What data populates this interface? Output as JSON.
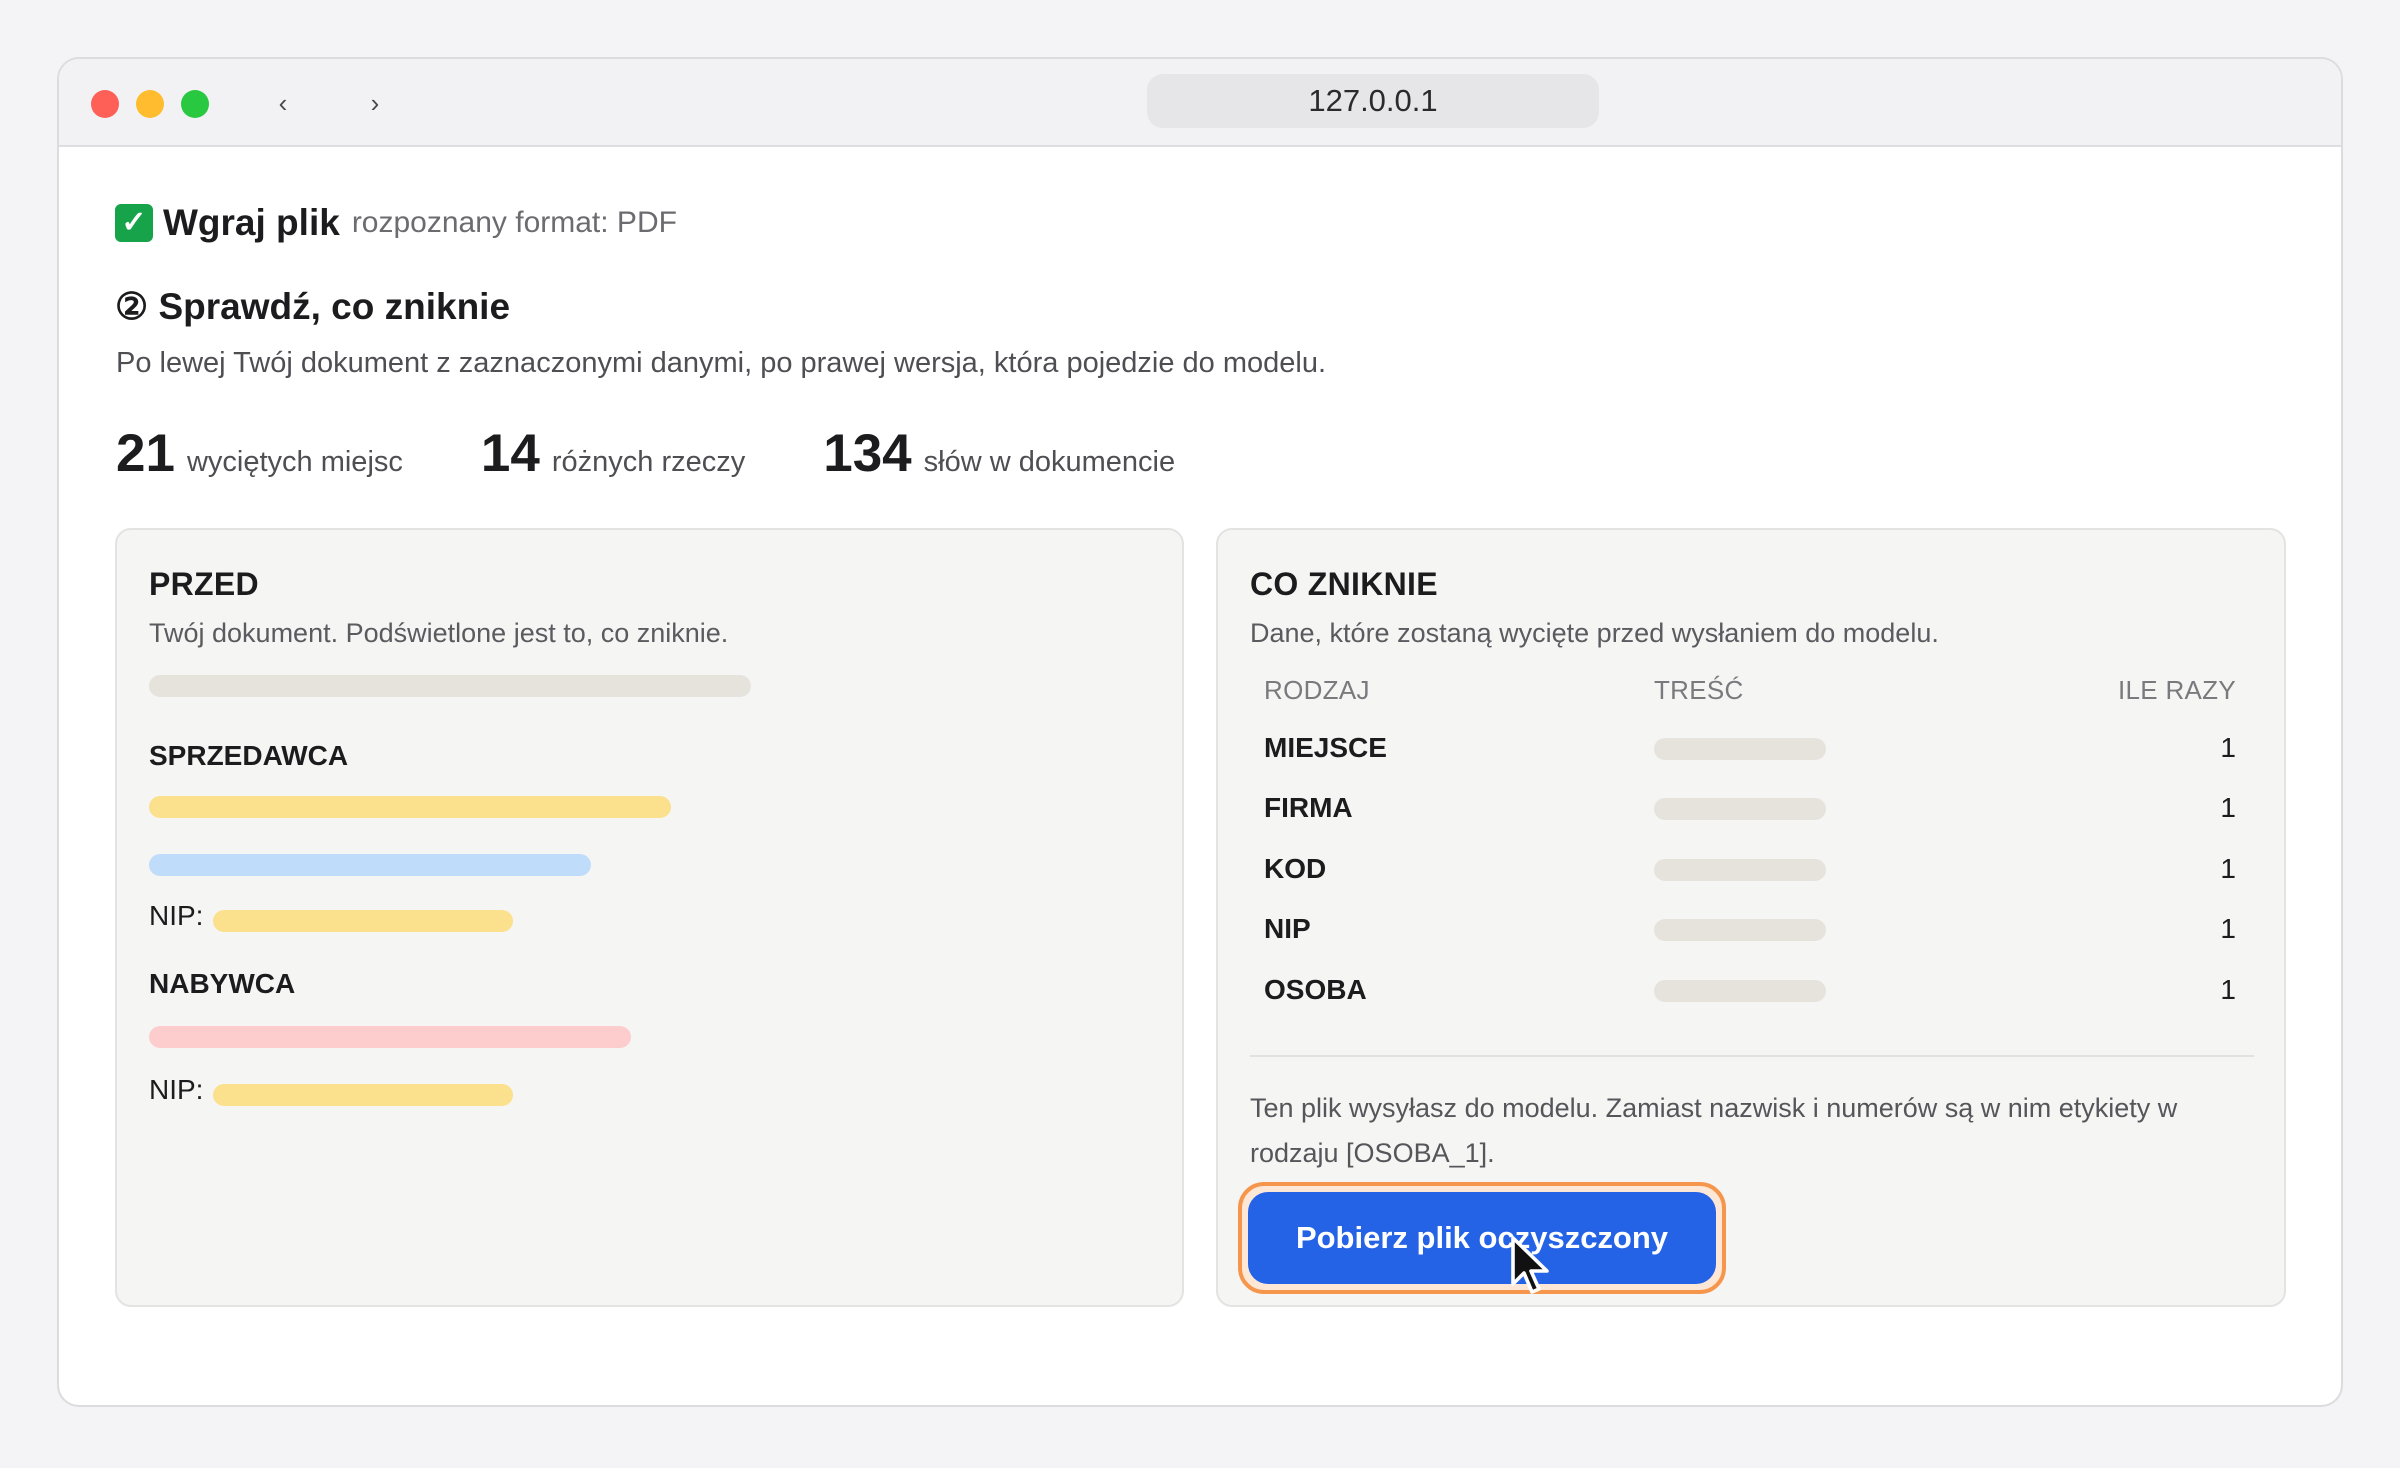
{
  "browser": {
    "url": "127.0.0.1",
    "back_icon": "‹",
    "forward_icon": "›"
  },
  "step1": {
    "check_icon": "✓",
    "title": "Wgraj plik",
    "subtitle": "rozpoznany format: PDF"
  },
  "step2": {
    "title": "② Sprawdź, co zniknie",
    "description": "Po lewej Twój dokument z zaznaczonymi danymi, po prawej wersja, która pojedzie do modelu."
  },
  "stats": [
    {
      "value": "21",
      "label": "wyciętych miejsc"
    },
    {
      "value": "14",
      "label": "różnych rzeczy"
    },
    {
      "value": "134",
      "label": "słów w dokumencie"
    }
  ],
  "before": {
    "title": "PRZED",
    "subtitle": "Twój dokument. Podświetlone jest to, co zniknie.",
    "seller_label": "SPRZEDAWCA",
    "buyer_label": "NABYWCA",
    "nip_label": "NIP:"
  },
  "removed": {
    "title": "CO ZNIKNIE",
    "subtitle": "Dane, które zostaną wycięte przed wysłaniem do modelu.",
    "columns": [
      "RODZAJ",
      "TREŚĆ",
      "ILE RAZY"
    ],
    "rows": [
      {
        "kind": "MIEJSCE",
        "count": "1"
      },
      {
        "kind": "FIRMA",
        "count": "1"
      },
      {
        "kind": "KOD",
        "count": "1"
      },
      {
        "kind": "NIP",
        "count": "1"
      },
      {
        "kind": "OSOBA",
        "count": "1"
      }
    ],
    "note": "Ten plik wysyłasz do modelu. Zamiast nazwisk i numerów są w nim etykiety w rodzaju [OSOBA_1].",
    "download_label": "Pobierz plik oczyszczony"
  },
  "colors": {
    "accent_button": "#2563e6",
    "focus_ring": "#f6964c",
    "highlight_yellow": "#fbe08d",
    "highlight_blue": "#bfdcfb",
    "highlight_pink": "#fdcdcd",
    "redacted_gray": "#e5e3dc"
  }
}
